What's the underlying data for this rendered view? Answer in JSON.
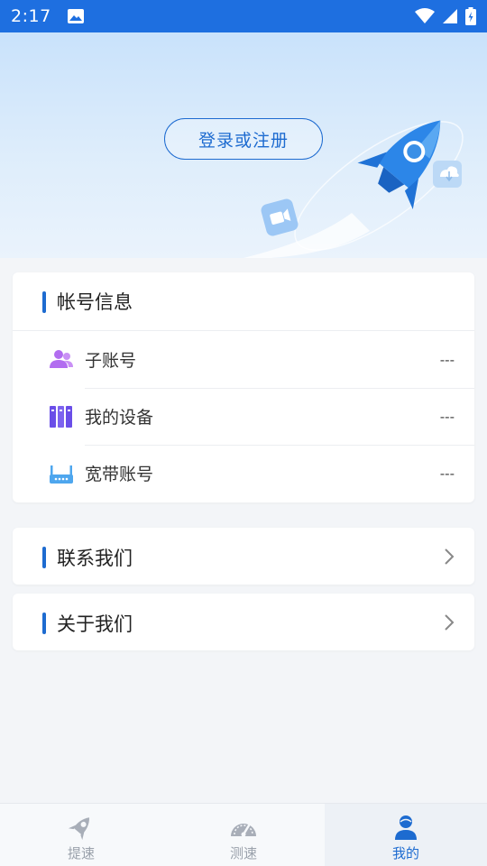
{
  "status_bar": {
    "time": "2:17",
    "icons": [
      "image-icon",
      "wifi-icon",
      "signal-icon",
      "battery-icon"
    ]
  },
  "hero": {
    "login_label": "登录或注册",
    "illustration": "rocket-illustration"
  },
  "account_section": {
    "title": "帐号信息",
    "items": [
      {
        "label": "子账号",
        "value": "---",
        "icon": "users-icon"
      },
      {
        "label": "我的设备",
        "value": "---",
        "icon": "devices-icon"
      },
      {
        "label": "宽带账号",
        "value": "---",
        "icon": "router-icon"
      }
    ]
  },
  "contact_section": {
    "title": "联系我们"
  },
  "about_section": {
    "title": "关于我们"
  },
  "tabbar": {
    "tabs": [
      {
        "label": "提速",
        "icon": "rocket-icon",
        "active": false
      },
      {
        "label": "测速",
        "icon": "speedometer-icon",
        "active": false
      },
      {
        "label": "我的",
        "icon": "profile-icon",
        "active": true
      }
    ]
  },
  "colors": {
    "accent": "#1d6bd0",
    "status_bar": "#1e6fe0",
    "background": "#f3f5f8",
    "users_icon": "#b26df0",
    "devices_icon": "#6a4ee8",
    "router_icon": "#4ea6ee"
  }
}
